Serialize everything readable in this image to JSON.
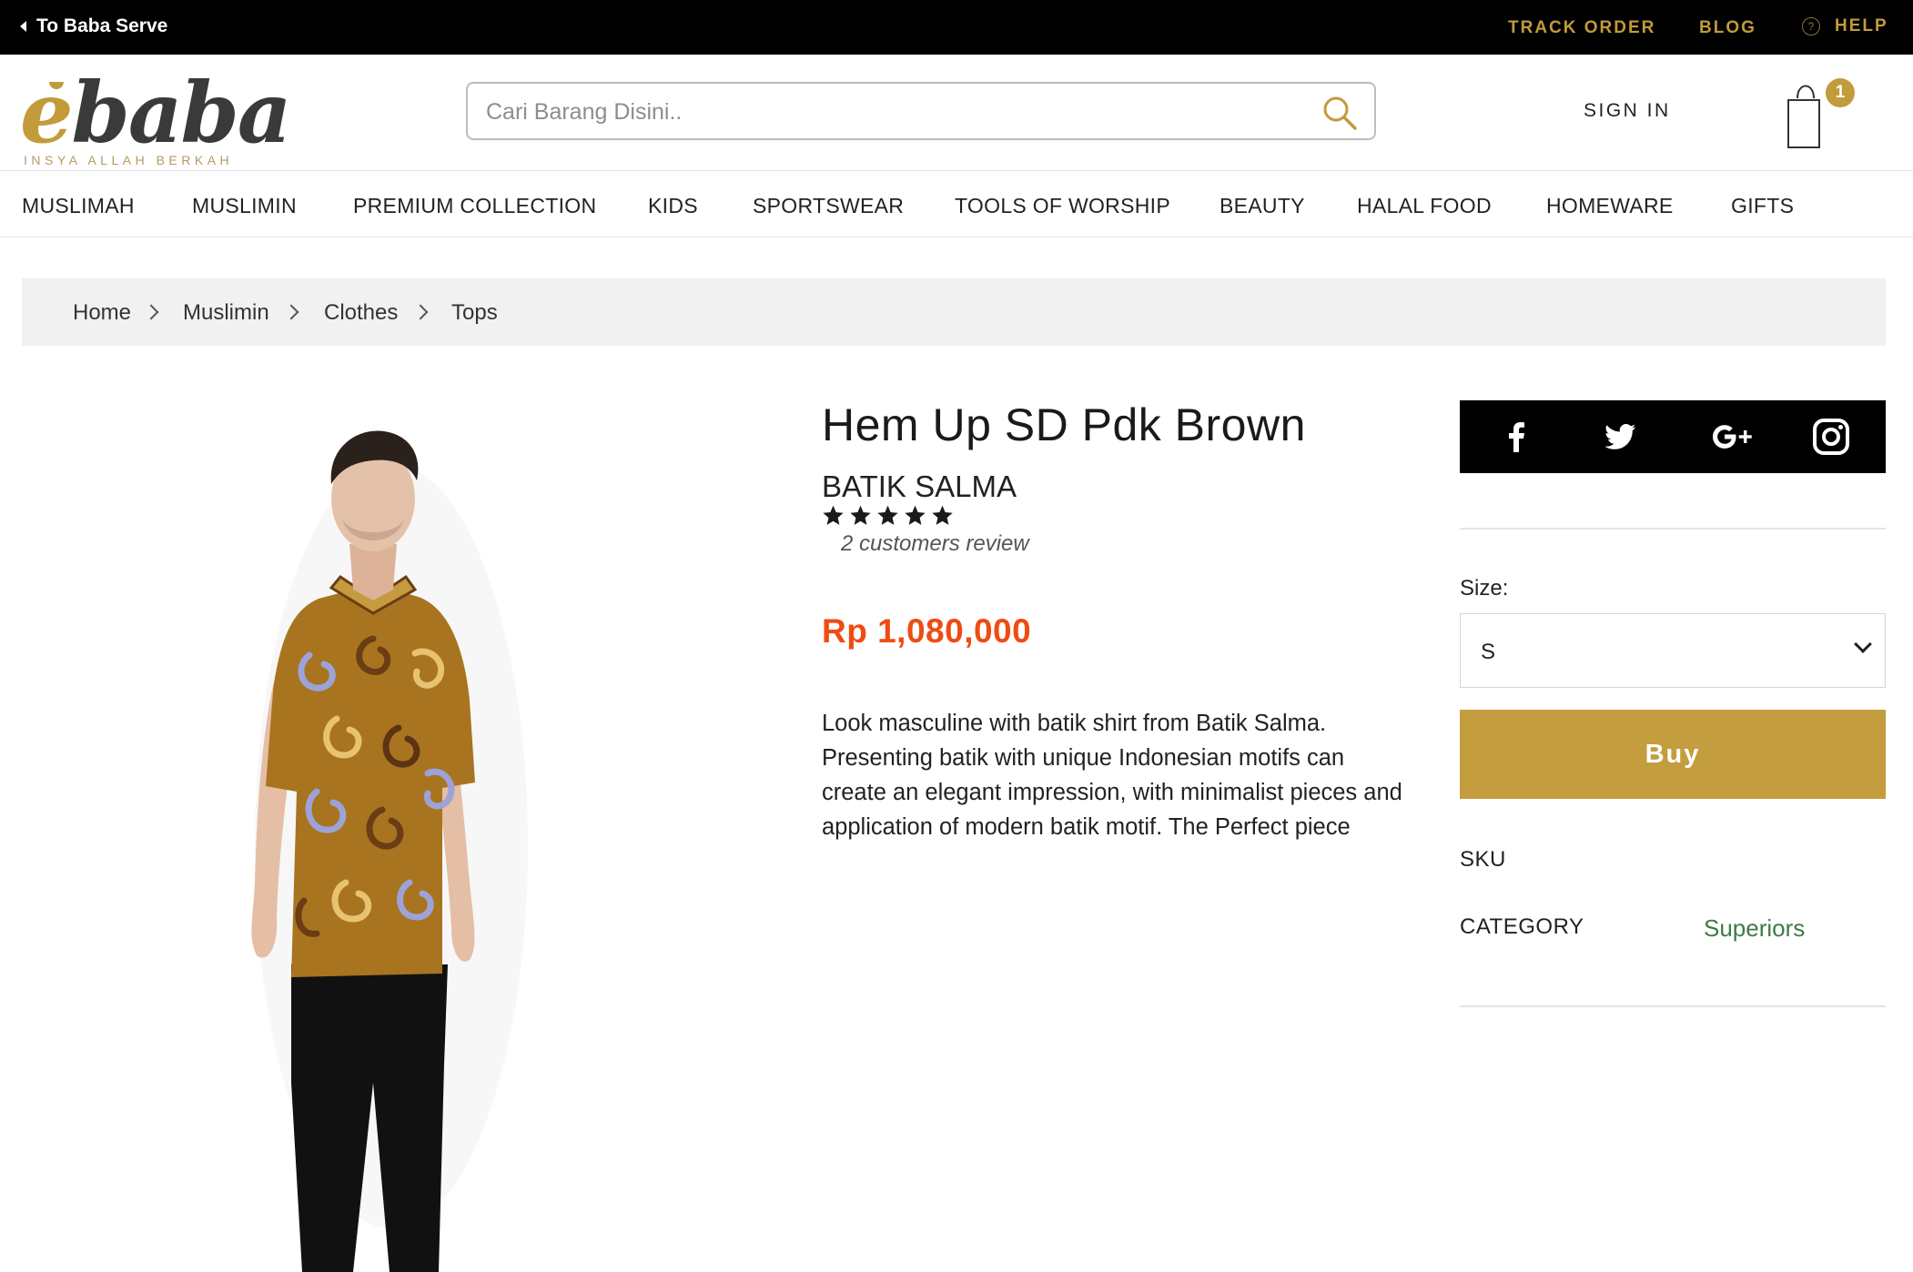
{
  "topbar": {
    "back_label": "To Baba Serve",
    "track_order": "TRACK ORDER",
    "blog": "BLOG",
    "help": "HELP"
  },
  "header": {
    "logo_word": "baba",
    "logo_letter": "e",
    "logo_tagline": "INSYA ALLAH BERKAH",
    "search_placeholder": "Cari Barang Disini..",
    "sign_in": "SIGN IN",
    "cart_count": "1"
  },
  "nav": {
    "items": [
      "MUSLIMAH",
      "MUSLIMIN",
      "PREMIUM COLLECTION",
      "KIDS",
      "SPORTSWEAR",
      "TOOLS OF WORSHIP",
      "BEAUTY",
      "HALAL FOOD",
      "HOMEWARE",
      "GIFTS"
    ]
  },
  "breadcrumb": [
    "Home",
    "Muslimin",
    "Clothes",
    "Tops"
  ],
  "product": {
    "title": "Hem Up SD Pdk Brown",
    "brand": "BATIK SALMA",
    "rating": 5,
    "rating_max": 5,
    "review_text": "2 customers review",
    "price": "Rp 1,080,000",
    "description": "Look masculine with batik shirt from Batik Salma. Presenting batik with unique Indonesian motifs can create an elegant impression, with minimalist pieces and application of modern batik motif. The Perfect piece",
    "image_icon": "model-in-batik-shirt"
  },
  "sidebar": {
    "social_icons": [
      "facebook-icon",
      "twitter-icon",
      "google-plus-icon",
      "instagram-icon"
    ],
    "size_label": "Size:",
    "size_value": "S",
    "buy_label": "Buy",
    "sku_label": "SKU",
    "category_label": "CATEGORY",
    "category_value": "Superiors"
  },
  "colors": {
    "gold": "#c29b3b",
    "buy_button": "#c39d3e",
    "price": "#f04b12",
    "category_link": "#3f7a44",
    "topbar_bg": "#000000"
  }
}
